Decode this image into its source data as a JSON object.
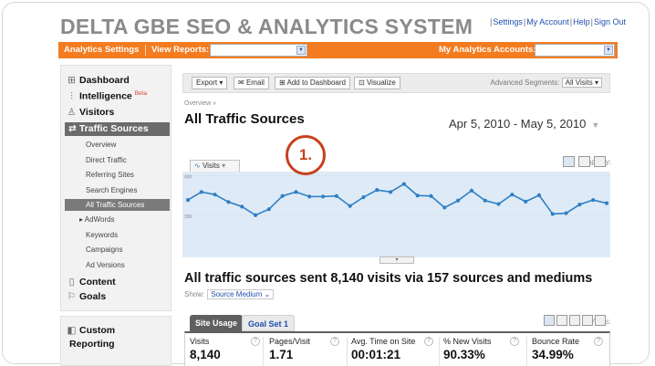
{
  "app": {
    "title": "DELTA GBE SEO & ANALYTICS SYSTEM",
    "top_links": [
      "Settings",
      "My Account",
      "Help",
      "Sign Out"
    ]
  },
  "orange_bar": {
    "analytics_settings": "Analytics Settings",
    "view_reports": "View Reports:",
    "my_accounts": "My Analytics Accounts:"
  },
  "sidebar": {
    "dashboard": "Dashboard",
    "intelligence": "Intelligence",
    "intelligence_badge": "Beta",
    "visitors": "Visitors",
    "traffic_sources": "Traffic Sources",
    "sub_items": [
      "Overview",
      "Direct Traffic",
      "Referring Sites",
      "Search Engines",
      "All Traffic Sources",
      "AdWords",
      "Keywords",
      "Campaigns",
      "Ad Versions"
    ],
    "content": "Content",
    "goals": "Goals",
    "custom": "Custom",
    "reporting": "Reporting"
  },
  "toolbar": {
    "export": "Export",
    "email": "Email",
    "add_to_dashboard": "Add to Dashboard",
    "visualize": "Visualize",
    "advanced_segments": "Advanced Segments:",
    "segment_value": "All Visits"
  },
  "report": {
    "breadcrumb": "Overview »",
    "title": "All Traffic Sources",
    "date_range": "Apr 5, 2010 - May 5, 2010",
    "callout": "1.",
    "graph_tab": "Visits",
    "graph_by": "Graph by:",
    "summary": "All traffic sources sent 8,140 visits via 157 sources and mediums",
    "show_label": "Show:",
    "show_value": "Source Medium",
    "views_label": "Views:"
  },
  "tabs": [
    "Site Usage",
    "Goal Set 1"
  ],
  "metrics": [
    {
      "label": "Visits",
      "value": "8,140"
    },
    {
      "label": "Pages/Visit",
      "value": "1.71"
    },
    {
      "label": "Avg. Time on Site",
      "value": "00:01:21"
    },
    {
      "label": "% New Visits",
      "value": "90.33%"
    },
    {
      "label": "Bounce Rate",
      "value": "34.99%"
    }
  ],
  "chart_data": {
    "type": "area",
    "y_tick_labels": [
      "400",
      "200"
    ],
    "ylim": [
      0,
      420
    ],
    "values": [
      278,
      318,
      305,
      268,
      245,
      202,
      232,
      298,
      318,
      295,
      295,
      298,
      248,
      292,
      328,
      318,
      358,
      300,
      298,
      240,
      275,
      325,
      275,
      258,
      305,
      270,
      302,
      208,
      212,
      255,
      278,
      262
    ],
    "colors": {
      "line": "#2f7fc4",
      "fill": "#deebf7",
      "grid": "#d6dde8"
    }
  }
}
